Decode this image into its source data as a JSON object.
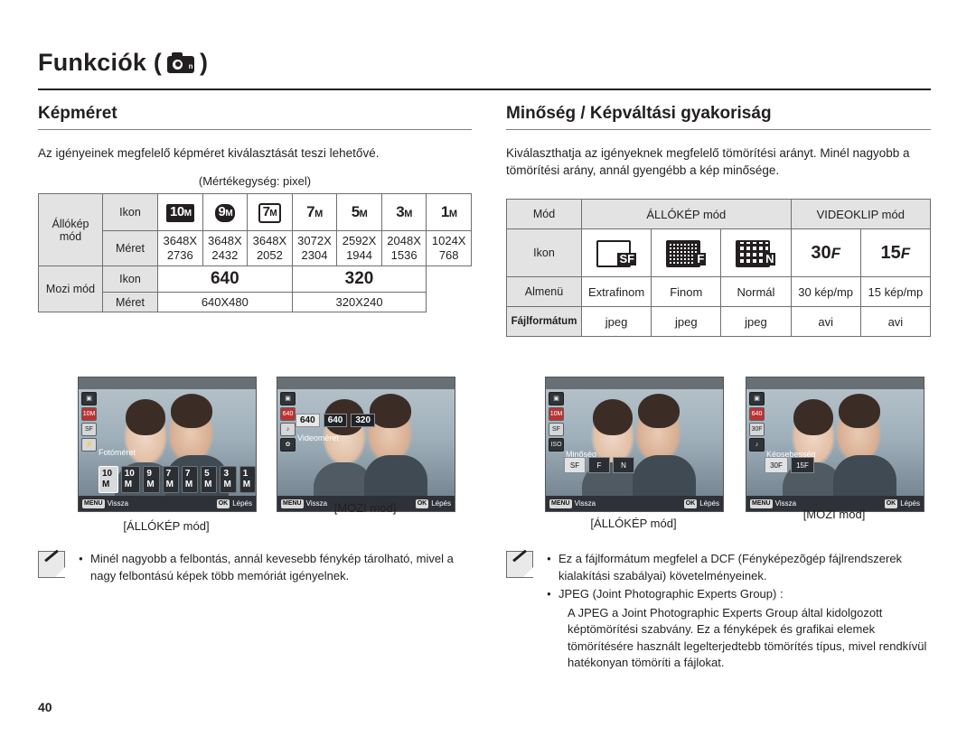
{
  "header": {
    "title_prefix": "Funkciók (",
    "title_suffix": ")",
    "icon_label": "camera-mode-icon"
  },
  "left": {
    "section_title": "Képméret",
    "intro": "Az igényeinek megfelelő képméret kiválasztását teszi lehetővé.",
    "unit_note": "(Mértékegység: pixel)",
    "table": {
      "row_mode_still": "Állókép mód",
      "row_mode_movie": "Mozi mód",
      "label_icon": "Ikon",
      "label_size": "Méret",
      "still_icons": [
        "10 M",
        "9 M",
        "7 M",
        "7 M",
        "5 M",
        "3 M",
        "1 M"
      ],
      "still_sizes_top": [
        "3648X",
        "3648X",
        "3648X",
        "3072X",
        "2592X",
        "2048X",
        "1024X"
      ],
      "still_sizes_bottom": [
        "2736",
        "2432",
        "2052",
        "2304",
        "1944",
        "1536",
        "768"
      ],
      "movie_icons": [
        "640",
        "320"
      ],
      "movie_sizes": [
        "640X480",
        "320X240"
      ]
    },
    "screens": [
      {
        "caption": "[ÁLLÓKÉP mód]",
        "menu_title": "Fotóméret",
        "back_label": "Vissza",
        "ok_label": "Lépés",
        "items": [
          "10 M",
          "10 M",
          "9 M",
          "7 M",
          "7 M",
          "5 M",
          "3 M",
          "1 M"
        ]
      },
      {
        "caption": "[MOZI mód]",
        "menu_title": "Videoméret",
        "back_label": "Vissza",
        "ok_label": "Lépés",
        "tabs": [
          "640",
          "640",
          "320"
        ]
      }
    ],
    "note": {
      "bullet": "Minél nagyobb a felbontás, annál kevesebb fénykép tárolható, mivel a nagy felbontású képek több memóriát igényelnek."
    }
  },
  "right": {
    "section_title": "Minőség / Képváltási gyakoriság",
    "intro": "Kiválaszthatja az igényeknek megfelelő tömörítési arányt. Minél nagyobb a tömörítési arány, annál gyengébb a kép minősége.",
    "table": {
      "label_mode": "Mód",
      "header_still": "ÁLLÓKÉP mód",
      "header_video": "VIDEOKLIP mód",
      "label_icon": "Ikon",
      "label_submenu": "Almenü",
      "label_format": "Fájlformátum",
      "submenus": [
        "Extrafinom",
        "Finom",
        "Normál",
        "30 kép/mp",
        "15 kép/mp"
      ],
      "formats": [
        "jpeg",
        "jpeg",
        "jpeg",
        "avi",
        "avi"
      ],
      "icons": [
        "SF",
        "F",
        "N",
        "30F",
        "15F"
      ]
    },
    "screens": [
      {
        "caption": "[ÁLLÓKÉP mód]",
        "menu_title": "Minőség",
        "back_label": "Vissza",
        "ok_label": "Lépés"
      },
      {
        "caption": "[MOZI mód]",
        "menu_title": "Képsebesség",
        "back_label": "Vissza",
        "ok_label": "Lépés",
        "badge": "640"
      }
    ],
    "note": {
      "items": [
        "Ez a fájlformátum megfelel a DCF (Fényképezõgép fájlrendszerek kialakítási szabályai) követelményeinek.",
        "JPEG (Joint Photographic Experts Group) :",
        "A JPEG a Joint Photographic Experts Group által kidolgozott képtömörítési szabvány. Ez a fényképek és grafikai elemek tömörítésére használt legelterjedtebb tömörítés típus, mivel rendkívül hatékonyan tömöríti a fájlokat."
      ]
    }
  },
  "footer": {
    "page_number": "40"
  }
}
